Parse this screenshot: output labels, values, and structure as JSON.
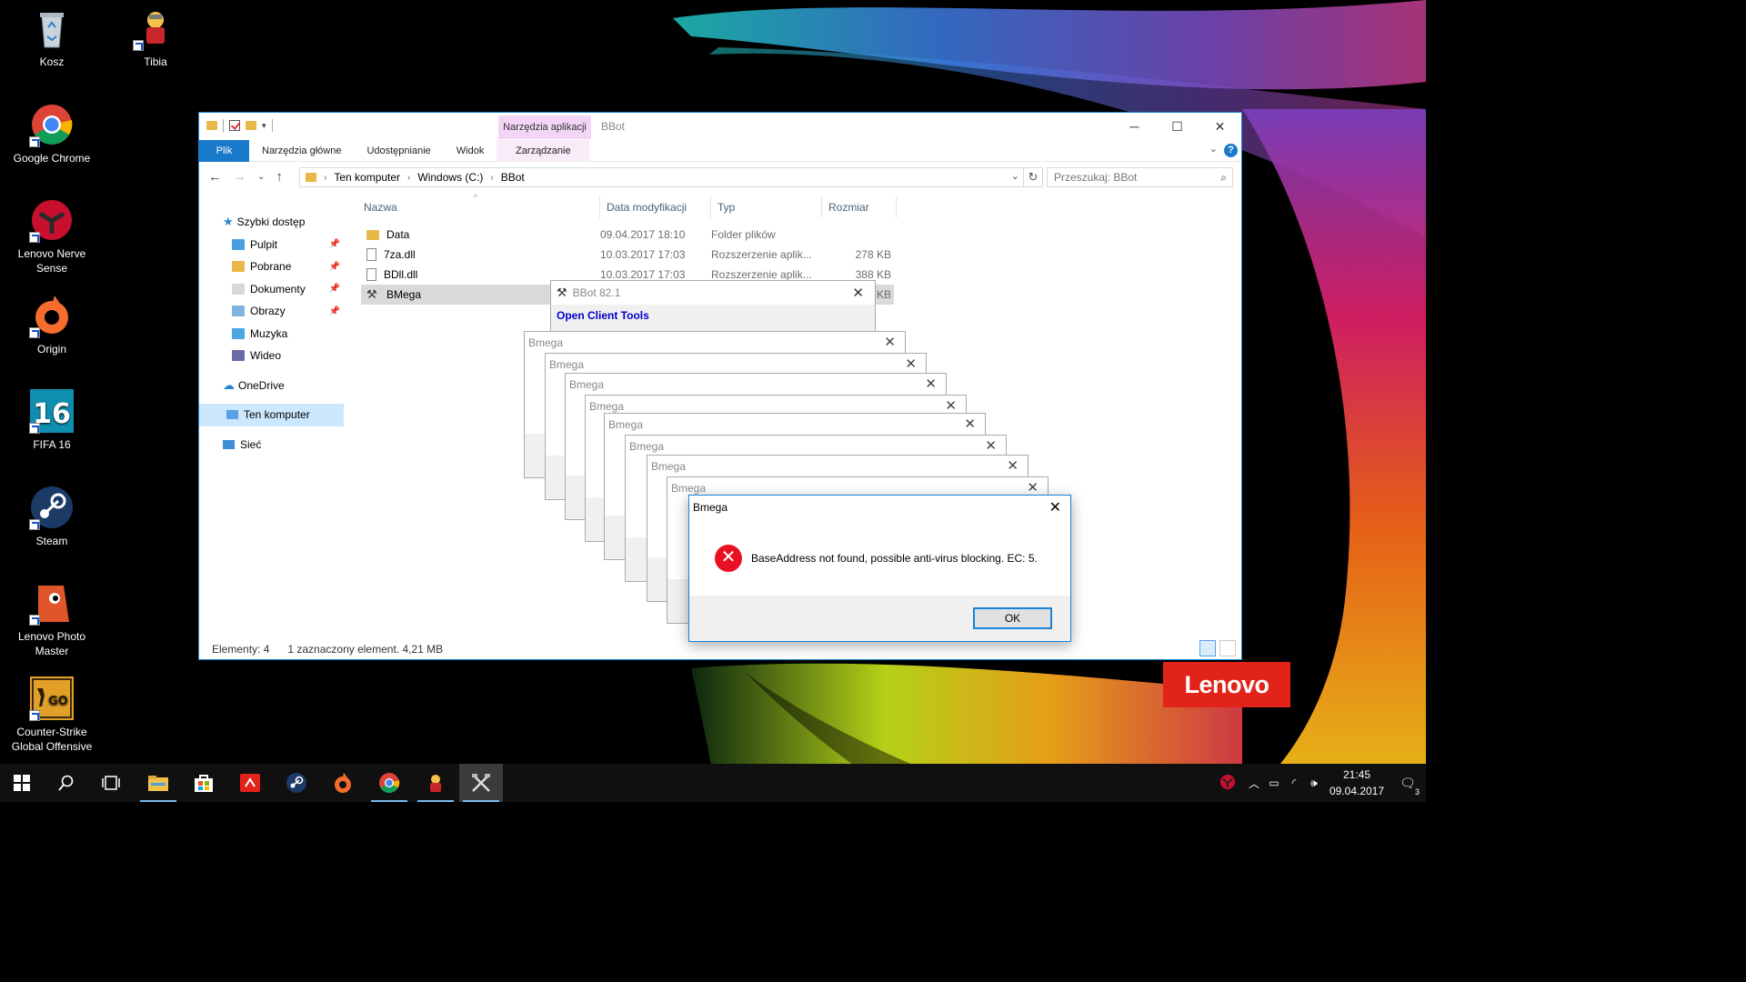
{
  "desktop": {
    "icons": [
      {
        "label": "Kosz",
        "icon": "recycle-bin-icon"
      },
      {
        "label": "Tibia",
        "icon": "tibia-icon"
      },
      {
        "label": "Google Chrome",
        "icon": "chrome-icon"
      },
      {
        "label": "Lenovo Nerve Sense",
        "icon": "lenovo-nerve-sense-icon"
      },
      {
        "label": "Origin",
        "icon": "origin-icon"
      },
      {
        "label": "FIFA 16",
        "icon": "fifa16-icon"
      },
      {
        "label": "Steam",
        "icon": "steam-icon"
      },
      {
        "label": "Lenovo Photo Master",
        "icon": "lenovo-photo-master-icon"
      },
      {
        "label": "Counter-Strike Global Offensive",
        "icon": "csgo-icon"
      }
    ],
    "brand_logo": "Lenovo",
    "brand_color": "#e2231a"
  },
  "explorer": {
    "title": "BBot",
    "context_tab_header": "Narzędzia aplikacji",
    "ribbon_tabs": [
      "Plik",
      "Narzędzia główne",
      "Udostępnianie",
      "Widok",
      "Zarządzanie"
    ],
    "breadcrumb": [
      "Ten komputer",
      "Windows (C:)",
      "BBot"
    ],
    "search_placeholder": "Przeszukaj: BBot",
    "nav": [
      {
        "label": "Szybki dostęp",
        "icon": "star-icon",
        "pinned": false
      },
      {
        "label": "Pulpit",
        "icon": "folder-icon",
        "pinned": true
      },
      {
        "label": "Pobrane",
        "icon": "download-folder-icon",
        "pinned": true
      },
      {
        "label": "Dokumenty",
        "icon": "documents-icon",
        "pinned": true
      },
      {
        "label": "Obrazy",
        "icon": "pictures-icon",
        "pinned": true
      },
      {
        "label": "Muzyka",
        "icon": "music-icon",
        "pinned": false
      },
      {
        "label": "Wideo",
        "icon": "video-icon",
        "pinned": false
      },
      {
        "label": "OneDrive",
        "icon": "onedrive-icon",
        "pinned": false
      },
      {
        "label": "Ten komputer",
        "icon": "computer-icon",
        "pinned": false
      },
      {
        "label": "Sieć",
        "icon": "network-icon",
        "pinned": false
      }
    ],
    "columns": [
      "Nazwa",
      "Data modyfikacji",
      "Typ",
      "Rozmiar"
    ],
    "files": [
      {
        "name": "Data",
        "date": "09.04.2017 18:10",
        "type": "Folder plików",
        "size": ""
      },
      {
        "name": "7za.dll",
        "date": "10.03.2017 17:03",
        "type": "Rozszerzenie aplik...",
        "size": "278 KB"
      },
      {
        "name": "BDll.dll",
        "date": "10.03.2017 17:03",
        "type": "Rozszerzenie aplik...",
        "size": "388 KB"
      },
      {
        "name": "BMega",
        "date": "",
        "type": "",
        "size": "KB"
      }
    ],
    "status": {
      "count": "Elementy: 4",
      "selection": "1 zaznaczony element. 4,21 MB"
    }
  },
  "bbot_window": {
    "title": "BBot 82.1",
    "menu_item": "Open Client Tools"
  },
  "bmega_cascade_title": "Bmega",
  "error_dialog": {
    "title": "Bmega",
    "message": "BaseAddress not found, possible anti-virus blocking. EC: 5.",
    "ok_label": "OK"
  },
  "taskbar": {
    "apps": [
      "start-icon",
      "search-icon",
      "task-view-icon",
      "file-explorer-icon",
      "store-icon",
      "lenovo-app-icon",
      "steam-icon",
      "origin-icon",
      "chrome-icon",
      "tibia-icon",
      "bmega-icon"
    ],
    "time": "21:45",
    "date": "09.04.2017",
    "notification_count": "3"
  }
}
